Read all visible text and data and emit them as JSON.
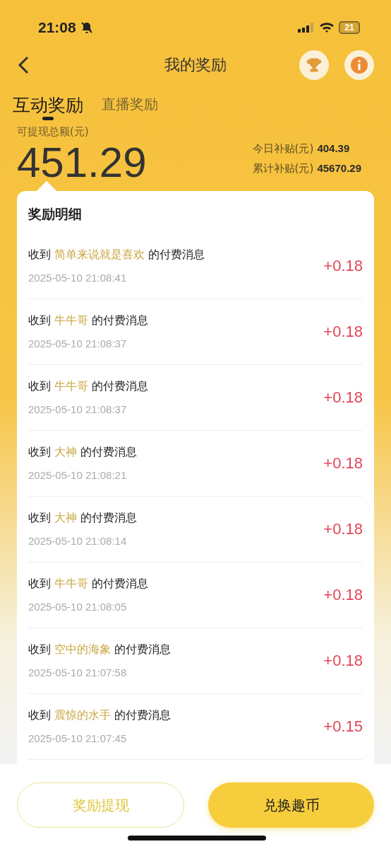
{
  "status_bar": {
    "time": "21:08",
    "battery": "21"
  },
  "nav": {
    "title": "我的奖励"
  },
  "tabs": [
    {
      "label": "互动奖励",
      "selected": true
    },
    {
      "label": "直播奖励",
      "selected": false
    }
  ],
  "summary": {
    "label": "可提现总额(元)",
    "amount": "451.29",
    "stats": [
      {
        "label": "今日补贴(元)",
        "value": "404.39"
      },
      {
        "label": "累计补贴(元)",
        "value": "45670.29"
      }
    ]
  },
  "details": {
    "title": "奖励明细",
    "rows": [
      {
        "prefix": "收到",
        "sender": "简单来说就是喜欢",
        "suffix": "的付费消息",
        "time": "2025-05-10 21:08:41",
        "amount": "+0.18"
      },
      {
        "prefix": "收到",
        "sender": "牛牛哥",
        "suffix": "的付费消息",
        "time": "2025-05-10 21:08:37",
        "amount": "+0.18"
      },
      {
        "prefix": "收到",
        "sender": "牛牛哥",
        "suffix": "的付费消息",
        "time": "2025-05-10 21:08:37",
        "amount": "+0.18"
      },
      {
        "prefix": "收到",
        "sender": "大神",
        "suffix": "的付费消息",
        "time": "2025-05-10 21:08:21",
        "amount": "+0.18"
      },
      {
        "prefix": "收到",
        "sender": "大神",
        "suffix": "的付费消息",
        "time": "2025-05-10 21:08:14",
        "amount": "+0.18"
      },
      {
        "prefix": "收到",
        "sender": "牛牛哥",
        "suffix": "的付费消息",
        "time": "2025-05-10 21:08:05",
        "amount": "+0.18"
      },
      {
        "prefix": "收到",
        "sender": "空中的海象",
        "suffix": "的付费消息",
        "time": "2025-05-10 21:07:58",
        "amount": "+0.18"
      },
      {
        "prefix": "收到",
        "sender": "震惊的水手",
        "suffix": "的付费消息",
        "time": "2025-05-10 21:07:45",
        "amount": "+0.15"
      }
    ]
  },
  "buttons": [
    {
      "label": "奖励提现",
      "kind": "outline"
    },
    {
      "label": "兑换趣币",
      "kind": "filled"
    }
  ]
}
